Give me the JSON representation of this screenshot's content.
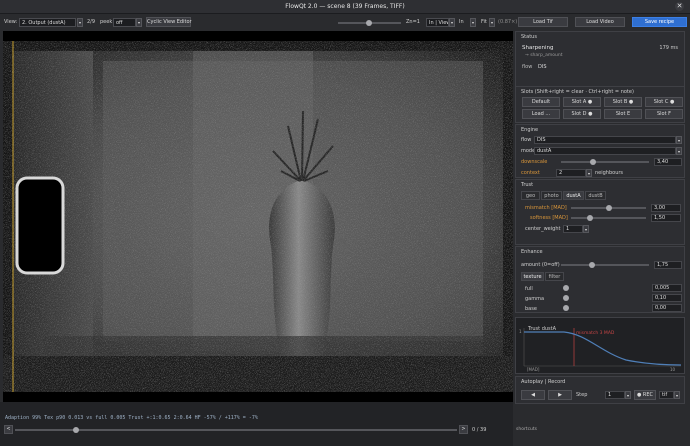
{
  "window": {
    "title": "FlowQt 2.0 — scene 8  (39 Frames, TIFF)",
    "close_glyph": "✕"
  },
  "toolbar": {
    "view_label": "View:",
    "view_value": "2. Output (dustA)",
    "frame_count": "2/9",
    "peek_label": "peek",
    "peek_value": "off",
    "cyclic_button": "Cyclic View Editor",
    "zoom_text": "Zn=1",
    "in_view": "In | View",
    "in_label": "In",
    "fit_label": "Fit",
    "zoom_pct": "(0.87×)",
    "load_tif": "Load Tif",
    "load_video": "Load Video",
    "save_recipe": "Save recipe"
  },
  "status_section": {
    "title": "Status",
    "stage": "Sharpening",
    "stage_time": "179 ms",
    "sub": "→ sharp_amount",
    "flow_label": "flow",
    "flow_value": "DIS"
  },
  "slots": {
    "title": "Slots  (Shift+right = clear · Ctrl+right = note)",
    "buttons": [
      "Default",
      "Slot A ●",
      "Slot B ●",
      "Slot C ●",
      "Load ...",
      "Slot D ●",
      "Slot E",
      "Slot F"
    ]
  },
  "engine": {
    "title": "Engine",
    "flow_label": "flow",
    "flow_value": "DIS",
    "mode_label": "mode",
    "mode_value": "dustA",
    "downscale_label": "downscale",
    "downscale_value": "3,40",
    "context_label": "context",
    "context_value": "2",
    "context_suffix": "neighbours"
  },
  "trust": {
    "title": "Trust",
    "tabs": [
      "geo",
      "photo",
      "dustA",
      "dustB"
    ],
    "active_tab": "dustA",
    "mismatch_label": "mismatch [MAD]",
    "mismatch_value": "3,00",
    "mismatch_level": 0.5,
    "softness_label": "softness [MAD]",
    "softness_value": "1,50",
    "softness_level": 0.25,
    "center_label": "center_weight",
    "center_value": "1"
  },
  "enhance": {
    "title": "Enhance",
    "amount_label": "amount (0=off)",
    "amount_value": "1,75",
    "amount_level": 0.35,
    "tabs": [
      "texture",
      "filter"
    ],
    "active_tab": "texture",
    "rows": [
      {
        "label": "full",
        "value": "0,005"
      },
      {
        "label": "gamma",
        "value": "0,10"
      },
      {
        "label": "base",
        "value": "0,00"
      }
    ]
  },
  "trust_plot": {
    "title": "Trust dustA",
    "marker_label": "mismatch 3 MAD",
    "y_top": "1",
    "x_left": "[MAD]",
    "x_right": "10"
  },
  "autoplay": {
    "title": "Autoplay | Record",
    "prev": "◀",
    "next": "▶",
    "step_label": "Step",
    "step_value": "1",
    "rec_label": "● REC",
    "format_value": "tif"
  },
  "statusbar": {
    "line": "Adaption 99%    Tex p90 0.013 vs full 0.005    Trust +:1:0.65  2:0.64    HF -57% / +117% = -7%",
    "frame_display": "0 / 39",
    "shortcuts": "shortcuts",
    "prev_glyph": "<",
    "next_glyph": ">"
  },
  "colors": {
    "accent": "#2f6fd1",
    "warning": "#d9963a",
    "curve": "#4f7fb8",
    "marker": "#c44444"
  }
}
